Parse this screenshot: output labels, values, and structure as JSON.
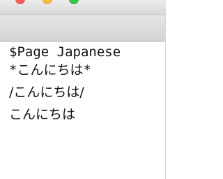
{
  "window": {
    "traffic_lights": {
      "close_color": "#fc605c",
      "minimize_color": "#fdbc40",
      "maximize_color": "#34c84a"
    }
  },
  "content": {
    "lines": [
      "$Page Japanese",
      "*こんにちは*",
      "/こんにちは/",
      "こんにちは"
    ]
  }
}
